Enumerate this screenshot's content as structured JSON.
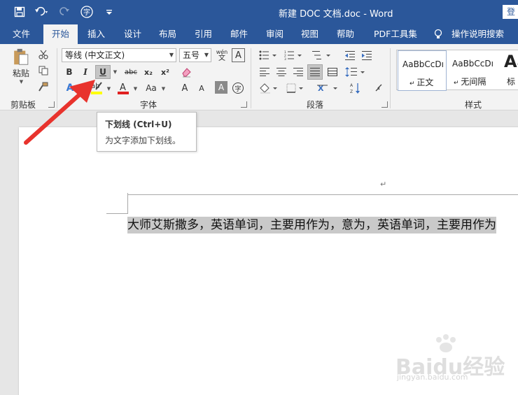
{
  "app": {
    "title": "新建 DOC 文档.doc  -  Word",
    "login_label": "登"
  },
  "qat": {
    "save_icon": "save-icon",
    "undo_icon": "undo-icon",
    "redo_icon": "redo-icon",
    "char_icon_label": "字",
    "customize_icon": "chevron-down-icon"
  },
  "tabs": [
    {
      "label": "文件"
    },
    {
      "label": "开始"
    },
    {
      "label": "插入"
    },
    {
      "label": "设计"
    },
    {
      "label": "布局"
    },
    {
      "label": "引用"
    },
    {
      "label": "邮件"
    },
    {
      "label": "审阅"
    },
    {
      "label": "视图"
    },
    {
      "label": "帮助"
    },
    {
      "label": "PDF工具集"
    },
    {
      "label": "操作说明搜索"
    }
  ],
  "active_tab": "开始",
  "clipboard": {
    "paste_label": "粘贴",
    "group_label": "剪贴板"
  },
  "font": {
    "font_name": "等线 (中文正文)",
    "font_size": "五号",
    "bold_label": "B",
    "italic_label": "I",
    "underline_label": "U",
    "strike_label": "abc",
    "sub_label": "x₂",
    "sup_label": "x²",
    "aa_label": "Aa",
    "grow_label": "A",
    "shrink_label": "A",
    "phonetic_label": "wén",
    "char_label": "字",
    "group_label": "字体"
  },
  "paragraph": {
    "group_label": "段落"
  },
  "styles": {
    "items": [
      {
        "sample": "AaBbCcDı",
        "name": "正文"
      },
      {
        "sample": "AaBbCcDı",
        "name": "无间隔"
      },
      {
        "sample": "Aa",
        "name": "标"
      }
    ],
    "group_label": "样式"
  },
  "tooltip": {
    "title": "下划线 (Ctrl+U)",
    "description": "为文字添加下划线。"
  },
  "document": {
    "selected_text": "大师艾斯撒多，英语单词，主要用作为，意为，英语单词，主要用作为"
  },
  "watermark": {
    "brand": "Baidu经验",
    "url": "jingyan.baidu.com"
  },
  "colors": {
    "accent": "#2b579a",
    "ribbon": "#f3f3f3",
    "highlight_selection": "#c9c9c9",
    "arrow": "#e8332d",
    "font_color_bar": "#e02020",
    "highlight_bar": "#ffff00"
  }
}
